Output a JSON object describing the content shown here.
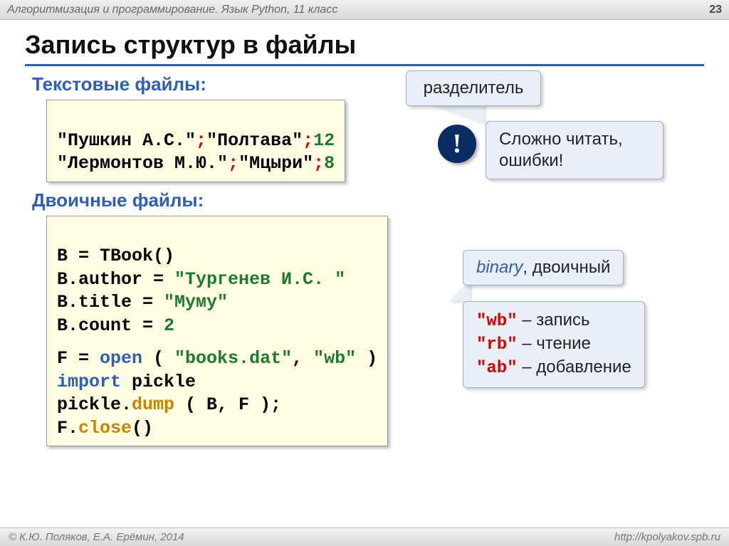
{
  "header": {
    "course": "Алгоритмизация и программирование. Язык Python, 11 класс",
    "page": "23"
  },
  "title": "Запись структур в файлы",
  "sections": {
    "text_files": "Текстовые файлы:",
    "binary_files": "Двоичные файлы:"
  },
  "code1": {
    "l1a": "\"Пушкин А.С.\"",
    "l1b": "\"Полтава\"",
    "l1c": "12",
    "l2a": "\"Лермонтов М.Ю.\"",
    "l2b": "\"Мцыри\"",
    "l2c": "8",
    "sep": ";"
  },
  "code2": {
    "l1": "B = TBook()",
    "l2a": "B.author = ",
    "l2b": "\"Тургенев И.С. \"",
    "l3a": "B.title = ",
    "l3b": "\"Муму\"",
    "l4a": "B.count = ",
    "l4b": "2",
    "l5a": "F = ",
    "l5b": "open",
    "l5c": " ( ",
    "l5d": "\"books.dat\"",
    "l5e": ", ",
    "l5f": "\"wb\"",
    "l5g": " )",
    "l6a": "import",
    "l6b": " pickle",
    "l7a": "pickle.",
    "l7b": "dump",
    "l7c": " ( B, F );",
    "l8a": "F.",
    "l8b": "close",
    "l8c": "()"
  },
  "callouts": {
    "separator": "разделитель",
    "warning": "Сложно читать, ошибки!",
    "binary_word": "binary",
    "binary_rest": ", двоичный",
    "modes": {
      "wb": "\"wb\"",
      "wb_t": " – запись",
      "rb": "\"rb\"",
      "rb_t": " – чтение",
      "ab": "\"ab\"",
      "ab_t": " – добавление"
    },
    "exclaim": "!"
  },
  "footer": {
    "left": "© К.Ю. Поляков, Е.А. Ерёмин, 2014",
    "right": "http://kpolyakov.spb.ru"
  }
}
